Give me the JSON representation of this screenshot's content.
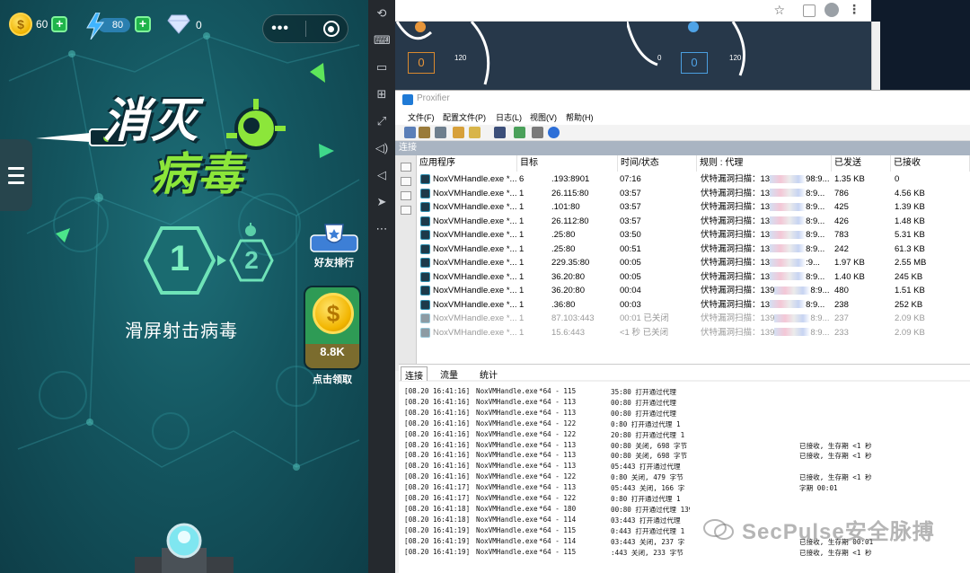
{
  "game": {
    "coins": "60",
    "coin_symbol": "$",
    "energy": "80",
    "diamonds": "0",
    "capsule_dots": "•••",
    "title_line1": "消灭",
    "title_line2": "病毒",
    "level_current": "1",
    "level_next": "2",
    "instruction": "滑屏射击病毒",
    "leaderboard_label": "好友排行",
    "reward_amount": "8.8K",
    "reward_claim": "点击领取"
  },
  "browser": {
    "gauge_left_value": "0",
    "gauge_right_value": "0",
    "gauge_tick_a": "120",
    "gauge_tick_b": "0",
    "gauge_tick_c": "120"
  },
  "proxifier": {
    "title": "Proxifier",
    "menu": [
      "文件(F)",
      "配置文件(P)",
      "日志(L)",
      "视图(V)",
      "帮助(H)"
    ],
    "section": "连接",
    "columns": [
      "应用程序",
      "目标",
      "时间/状态",
      "规则 : 代理",
      "已发送",
      "已接收"
    ],
    "rows": [
      {
        "app": "NoxVMHandle.exe *...",
        "pid": "6",
        "target": ".193:8901",
        "time": "07:16",
        "rule": "伏特漏洞扫描：13",
        "rule_tail": "98:9...",
        "sent": "1.35 KB",
        "recv": "0",
        "done": false
      },
      {
        "app": "NoxVMHandle.exe *...",
        "pid": "1",
        "target": "26.115:80",
        "time": "03:57",
        "rule": "伏特漏洞扫描：13",
        "rule_tail": "8:9...",
        "sent": "786",
        "recv": "4.56 KB",
        "done": false
      },
      {
        "app": "NoxVMHandle.exe *...",
        "pid": "1",
        "target": ".101:80",
        "time": "03:57",
        "rule": "伏特漏洞扫描：13",
        "rule_tail": "8:9...",
        "sent": "425",
        "recv": "1.39 KB",
        "done": false
      },
      {
        "app": "NoxVMHandle.exe *...",
        "pid": "1",
        "target": "26.112:80",
        "time": "03:57",
        "rule": "伏特漏洞扫描：13",
        "rule_tail": "8:9...",
        "sent": "426",
        "recv": "1.48 KB",
        "done": false
      },
      {
        "app": "NoxVMHandle.exe *...",
        "pid": "1",
        "target": ".25:80",
        "time": "03:50",
        "rule": "伏特漏洞扫描：13",
        "rule_tail": "8:9...",
        "sent": "783",
        "recv": "5.31 KB",
        "done": false
      },
      {
        "app": "NoxVMHandle.exe *...",
        "pid": "1",
        "target": ".25:80",
        "time": "00:51",
        "rule": "伏特漏洞扫描：13",
        "rule_tail": "8:9...",
        "sent": "242",
        "recv": "61.3 KB",
        "done": false
      },
      {
        "app": "NoxVMHandle.exe *...",
        "pid": "1",
        "target": "229.35:80",
        "time": "00:05",
        "rule": "伏特漏洞扫描：13",
        "rule_tail": ":9...",
        "sent": "1.97 KB",
        "recv": "2.55 MB",
        "done": false
      },
      {
        "app": "NoxVMHandle.exe *...",
        "pid": "1",
        "target": "36.20:80",
        "time": "00:05",
        "rule": "伏特漏洞扫描：13",
        "rule_tail": "8:9...",
        "sent": "1.40 KB",
        "recv": "245 KB",
        "done": false
      },
      {
        "app": "NoxVMHandle.exe *...",
        "pid": "1",
        "target": "36.20:80",
        "time": "00:04",
        "rule": "伏特漏洞扫描：139",
        "rule_tail": "8:9...",
        "sent": "480",
        "recv": "1.51 KB",
        "done": false
      },
      {
        "app": "NoxVMHandle.exe *...",
        "pid": "1",
        "target": ".36:80",
        "time": "00:03",
        "rule": "伏特漏洞扫描：13",
        "rule_tail": "8:9...",
        "sent": "238",
        "recv": "252 KB",
        "done": false
      },
      {
        "app": "NoxVMHandle.exe *...",
        "pid": "1",
        "target": "87.103:443",
        "time": "00:01 已关闭",
        "rule": "伏特漏洞扫描：139",
        "rule_tail": "8:9...",
        "sent": "237",
        "recv": "2.09 KB",
        "done": true
      },
      {
        "app": "NoxVMHandle.exe *...",
        "pid": "1",
        "target": "15.6:443",
        "time": "<1 秒 已关闭",
        "rule": "伏特漏洞扫描：139",
        "rule_tail": "8:9...",
        "sent": "233",
        "recv": "2.09 KB",
        "done": true
      }
    ],
    "tabs": [
      "连接",
      "流量",
      "统计"
    ],
    "log": [
      {
        "time": "[08.20 16:41:16]",
        "proc": "NoxVMHandle.exe",
        "pid": "*64 - 115",
        "act": "35:80 打开通过代理",
        "ext": ""
      },
      {
        "time": "[08.20 16:41:16]",
        "proc": "NoxVMHandle.exe",
        "pid": "*64 - 113",
        "act": "00:80 打开通过代理",
        "ext": ""
      },
      {
        "time": "[08.20 16:41:16]",
        "proc": "NoxVMHandle.exe",
        "pid": "*64 - 113",
        "act": "00:80 打开通过代理",
        "ext": ""
      },
      {
        "time": "[08.20 16:41:16]",
        "proc": "NoxVMHandle.exe",
        "pid": "*64 - 122",
        "act": "0:80 打开通过代理 1",
        "ext": ""
      },
      {
        "time": "[08.20 16:41:16]",
        "proc": "NoxVMHandle.exe",
        "pid": "*64 - 122",
        "act": "20:80 打开通过代理 1",
        "ext": ""
      },
      {
        "time": "[08.20 16:41:16]",
        "proc": "NoxVMHandle.exe",
        "pid": "*64 - 113",
        "act": "00:80 关闭, 698 字节",
        "ext": "已接收, 生存期 <1 秒"
      },
      {
        "time": "[08.20 16:41:16]",
        "proc": "NoxVMHandle.exe",
        "pid": "*64 - 113",
        "act": "00:80 关闭, 698 字节",
        "ext": "已接收, 生存期 <1 秒"
      },
      {
        "time": "[08.20 16:41:16]",
        "proc": "NoxVMHandle.exe",
        "pid": "*64 - 113",
        "act": "05:443 打开通过代理",
        "ext": ""
      },
      {
        "time": "[08.20 16:41:16]",
        "proc": "NoxVMHandle.exe",
        "pid": "*64 - 122",
        "act": "0:80 关闭, 479 字节",
        "ext": "已接收, 生存期 <1 秒"
      },
      {
        "time": "[08.20 16:41:17]",
        "proc": "NoxVMHandle.exe",
        "pid": "*64 - 113",
        "act": "05:443 关闭, 166 字",
        "ext": "字期 00:01"
      },
      {
        "time": "[08.20 16:41:17]",
        "proc": "NoxVMHandle.exe",
        "pid": "*64 - 122",
        "act": "0:80 打开通过代理 1",
        "ext": ""
      },
      {
        "time": "[08.20 16:41:18]",
        "proc": "NoxVMHandle.exe",
        "pid": "*64 - 180",
        "act": "00:80 打开通过代理 139",
        "ext": ""
      },
      {
        "time": "[08.20 16:41:18]",
        "proc": "NoxVMHandle.exe",
        "pid": "*64 - 114",
        "act": "03:443 打开通过代理",
        "ext": ""
      },
      {
        "time": "[08.20 16:41:19]",
        "proc": "NoxVMHandle.exe",
        "pid": "*64 - 115",
        "act": "0:443 打开通过代理 1",
        "ext": ""
      },
      {
        "time": "[08.20 16:41:19]",
        "proc": "NoxVMHandle.exe",
        "pid": "*64 - 114",
        "act": "03:443 关闭, 237 字",
        "ext": "已接收, 生存期 00:01"
      },
      {
        "time": "[08.20 16:41:19]",
        "proc": "NoxVMHandle.exe",
        "pid": "*64 - 115",
        "act": ":443 关闭, 233 字节",
        "ext": "已接收, 生存期 <1 秒"
      }
    ]
  },
  "watermark": "SecPulse安全脉搏",
  "colors": {
    "game_bg": "#145660",
    "accent_green": "#8ce63a",
    "proxifier_header": "#a9b4c2"
  }
}
